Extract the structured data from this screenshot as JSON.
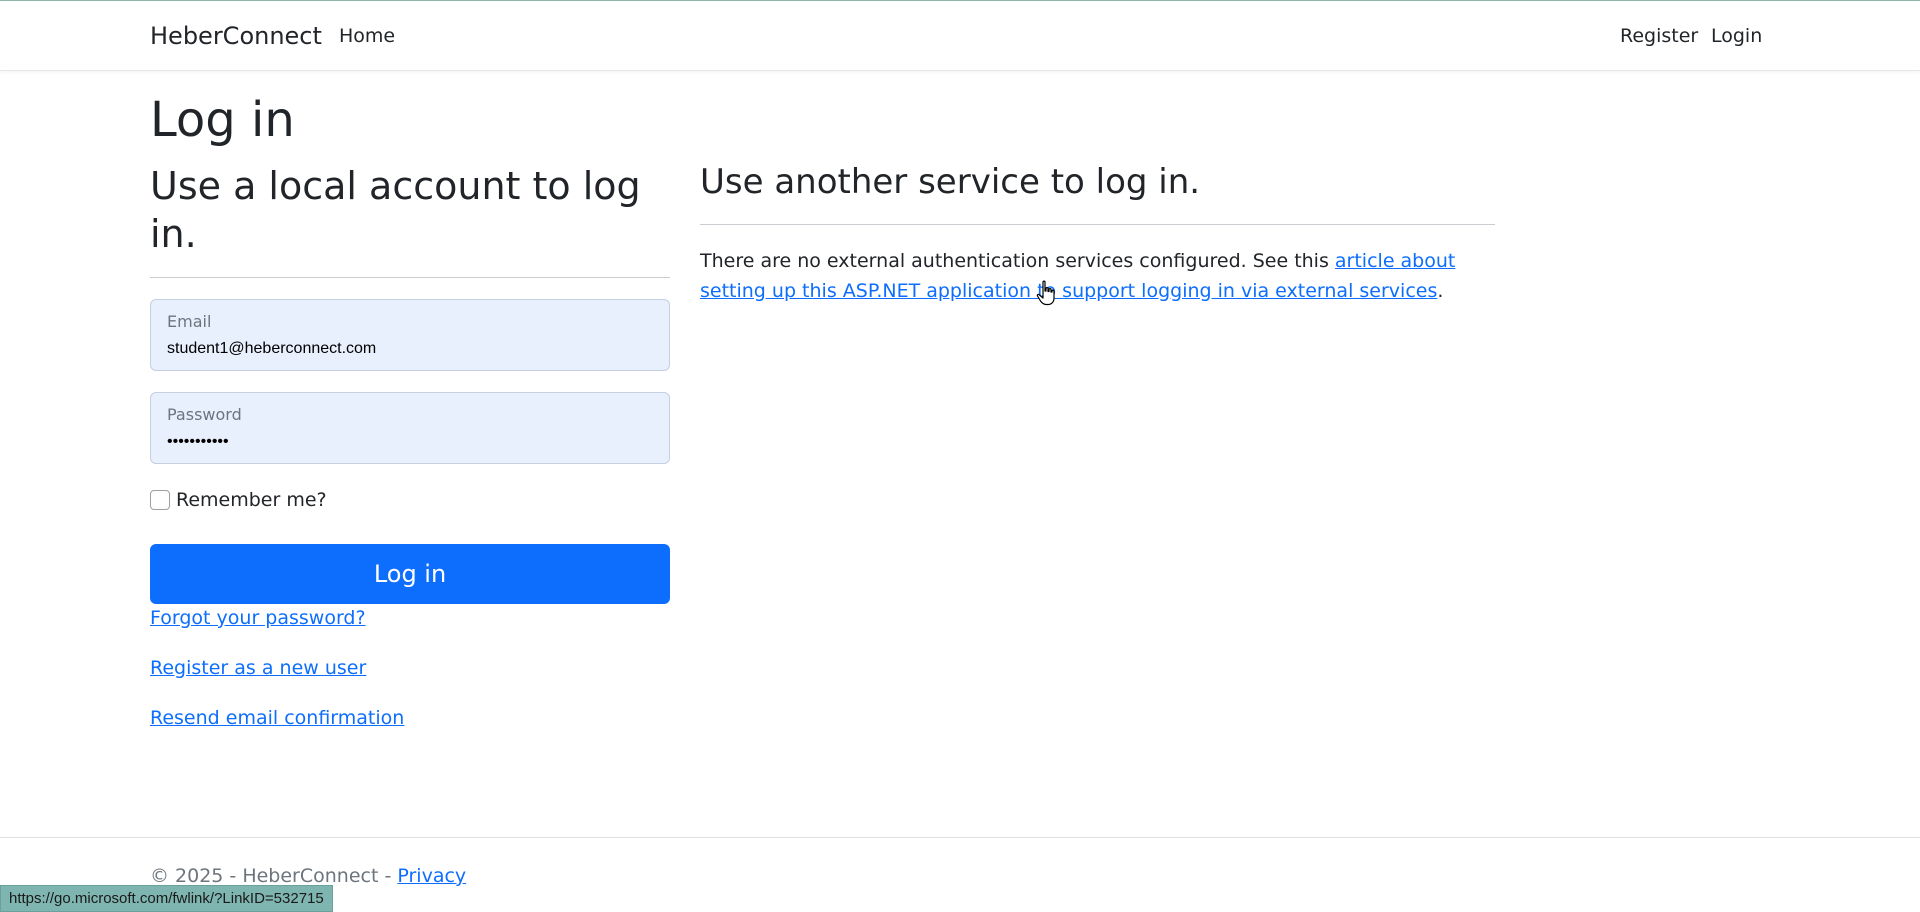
{
  "navbar": {
    "brand": "HeberConnect",
    "home": "Home",
    "register": "Register",
    "login": "Login"
  },
  "page": {
    "title": "Log in",
    "local_heading": "Use a local account to log in.",
    "email_label": "Email",
    "email_value": "student1@heberconnect.com",
    "password_label": "Password",
    "password_value": "•••••••••••",
    "remember_label": "Remember me?",
    "login_button": "Log in",
    "forgot_link": "Forgot your password?",
    "register_link": "Register as a new user",
    "resend_link": "Resend email confirmation"
  },
  "external": {
    "heading": "Use another service to log in.",
    "text_before": "There are no external authentication services configured. See this ",
    "link_text": "article about setting up this ASP.NET application to support logging in via external services",
    "text_after": "."
  },
  "footer": {
    "copyright": "© 2025 - HeberConnect - ",
    "privacy": "Privacy"
  },
  "status_bar": {
    "url": "https://go.microsoft.com/fwlink/?LinkID=532715"
  },
  "colors": {
    "primary": "#0d6efd",
    "field_bg": "#e8f0fe",
    "status_bar_bg": "#7fb5b0"
  },
  "icons": {
    "cursor": "hand-pointer-icon"
  }
}
